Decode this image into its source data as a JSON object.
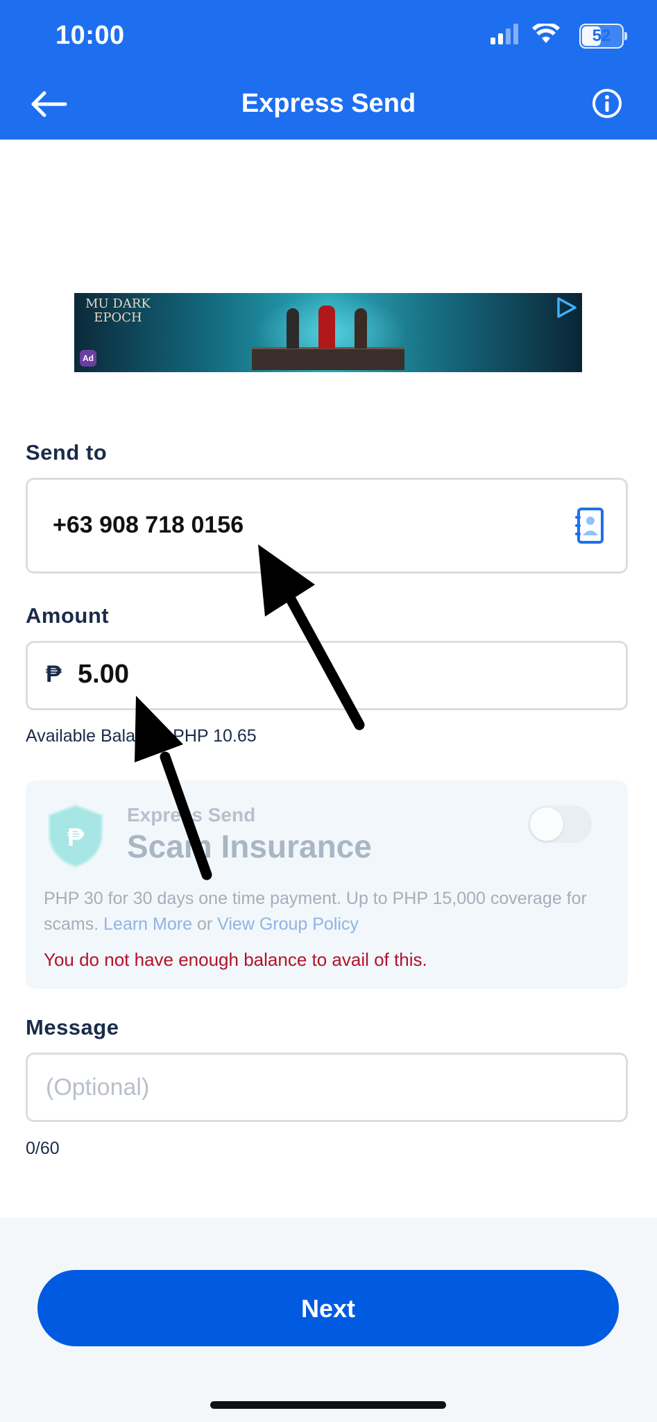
{
  "status_bar": {
    "time": "10:00",
    "battery": "52",
    "battery_level_percent": 52
  },
  "header": {
    "title": "Express Send",
    "back_icon": "back-arrow-icon",
    "info_icon": "info-icon"
  },
  "ad": {
    "logo_text": "MU DARK EPOCH",
    "badge": "Ad"
  },
  "send_to": {
    "label": "Send to",
    "value": "+63 908 718 0156",
    "contacts_icon": "contacts-icon"
  },
  "amount": {
    "label": "Amount",
    "currency_symbol": "₱",
    "value": "5.00"
  },
  "balance": {
    "text": "Available Balance: PHP 10.65"
  },
  "insurance": {
    "subtitle": "Express Send",
    "title": "Scam Insurance",
    "toggle_on": false,
    "description": "PHP 30 for 30 days one time payment. Up to PHP 15,000 coverage for scams.",
    "learn_more": "Learn More",
    "or_text": "or",
    "policy_link": "View Group Policy",
    "error": "You do not have enough balance to avail of this."
  },
  "message": {
    "label": "Message",
    "placeholder": "(Optional)",
    "counter": "0/60"
  },
  "footer": {
    "next_label": "Next"
  },
  "colors": {
    "brand_blue": "#1e6ff0",
    "button_blue": "#005be0",
    "error_red": "#b3122a"
  }
}
